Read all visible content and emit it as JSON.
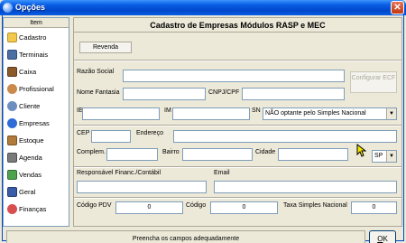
{
  "window": {
    "title": "Opções",
    "close_glyph": "✕"
  },
  "sidebar": {
    "header": "Item",
    "items": [
      {
        "label": "Cadastro",
        "icon": "folder-icon",
        "color": "#F2C94C"
      },
      {
        "label": "Terminais",
        "icon": "terminal-icon",
        "color": "#4A6FA5"
      },
      {
        "label": "Caixa",
        "icon": "cash-register-icon",
        "color": "#8B5A2B"
      },
      {
        "label": "Profissional",
        "icon": "user-icon",
        "color": "#C98A4B"
      },
      {
        "label": "Cliente",
        "icon": "client-icon",
        "color": "#6C8EBF"
      },
      {
        "label": "Empresas",
        "icon": "info-icon",
        "color": "#2E6BD6"
      },
      {
        "label": "Estoque",
        "icon": "stock-icon",
        "color": "#B07A3A"
      },
      {
        "label": "Agenda",
        "icon": "agenda-icon",
        "color": "#7A7A7A"
      },
      {
        "label": "Vendas",
        "icon": "sales-icon",
        "color": "#4FA34F"
      },
      {
        "label": "Geral",
        "icon": "general-icon",
        "color": "#3B5BA9"
      },
      {
        "label": "Finanças",
        "icon": "finance-icon",
        "color": "#D94F4F"
      }
    ],
    "selected": "Empresas"
  },
  "main": {
    "title": "Cadastro de Empresas Módulos RASP e MEC",
    "tab": "Revenda",
    "labels": {
      "razao_social": "Razão Social",
      "nome_fantasia": "Nome Fantasia",
      "cnpj_cpf": "CNPJ/CPF",
      "ie": "IE",
      "im": "IM",
      "sn": "SN",
      "cep": "CEP",
      "endereco": "Endereço",
      "complem": "Complem.",
      "bairro": "Bairro",
      "cidade": "Cidade",
      "responsavel": "Responsável Financ./Contábil",
      "email": "Email",
      "codigo_pdv": "Código PDV",
      "codigo": "Código",
      "taxa_simples": "Taxa Simples Nacional"
    },
    "values": {
      "sn": "NÃO optante pelo Simples Nacional",
      "uf": "SP",
      "codigo_pdv": "0",
      "codigo": "0",
      "taxa_simples": "0"
    },
    "configurar_ecf": "Configurar ECF"
  },
  "status": {
    "message": "Preencha os campos adequadamente"
  },
  "ok_button": {
    "label_u": "O",
    "label_rest": "K"
  }
}
